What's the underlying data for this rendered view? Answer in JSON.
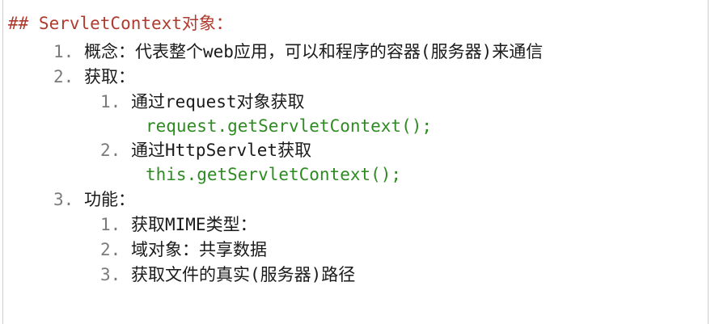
{
  "heading": "## ServletContext对象：",
  "items": [
    {
      "number": "1.",
      "text": "概念：代表整个web应用，可以和程序的容器(服务器)来通信"
    },
    {
      "number": "2.",
      "text": "获取：",
      "subitems": [
        {
          "number": "1.",
          "text": "通过request对象获取",
          "code": "request.getServletContext();"
        },
        {
          "number": "2.",
          "text": "通过HttpServlet获取",
          "code": "this.getServletContext();"
        }
      ]
    },
    {
      "number": "3.",
      "text": "功能：",
      "subitems": [
        {
          "number": "1.",
          "text": "获取MIME类型："
        },
        {
          "number": "2.",
          "text": "域对象：共享数据"
        },
        {
          "number": "3.",
          "text": "获取文件的真实(服务器)路径"
        }
      ]
    }
  ],
  "colors": {
    "heading": "#b03a2e",
    "code": "#2e8b22",
    "number": "#7a7a7a",
    "text": "#1a1a1a"
  }
}
